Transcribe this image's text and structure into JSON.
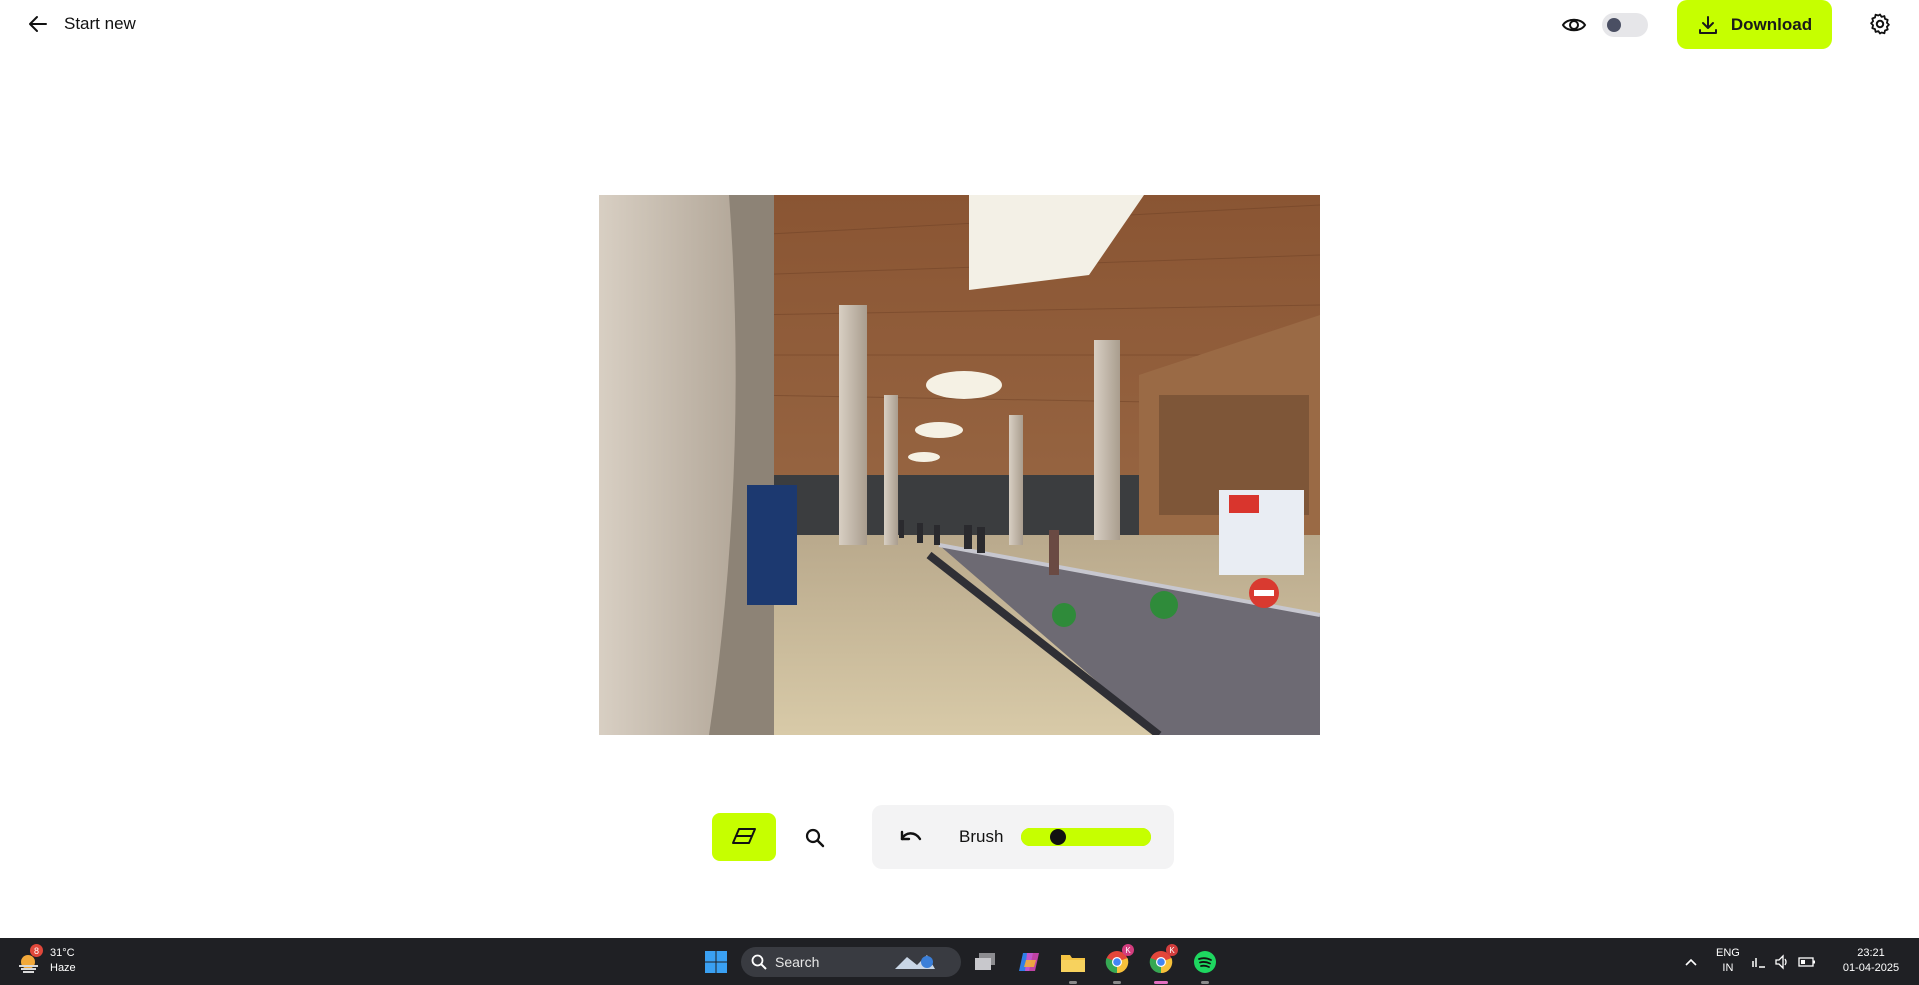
{
  "header": {
    "back_label": "Start new",
    "download_label": "Download",
    "preview_toggle_on": false
  },
  "canvas": {
    "image_description_icon": "photo"
  },
  "tools": {
    "eraser_active": true,
    "brush_label": "Brush",
    "brush_size_fraction": 0.25
  },
  "taskbar": {
    "weather": {
      "temp": "31°C",
      "condition": "Haze",
      "badge": "8"
    },
    "search_placeholder": "Search",
    "tray": {
      "lang_top": "ENG",
      "lang_bottom": "IN",
      "time": "23:21",
      "date": "01-04-2025"
    },
    "chrome_badge": "K"
  },
  "colors": {
    "accent": "#c6ff00",
    "taskbar_bg": "#1f2024"
  }
}
